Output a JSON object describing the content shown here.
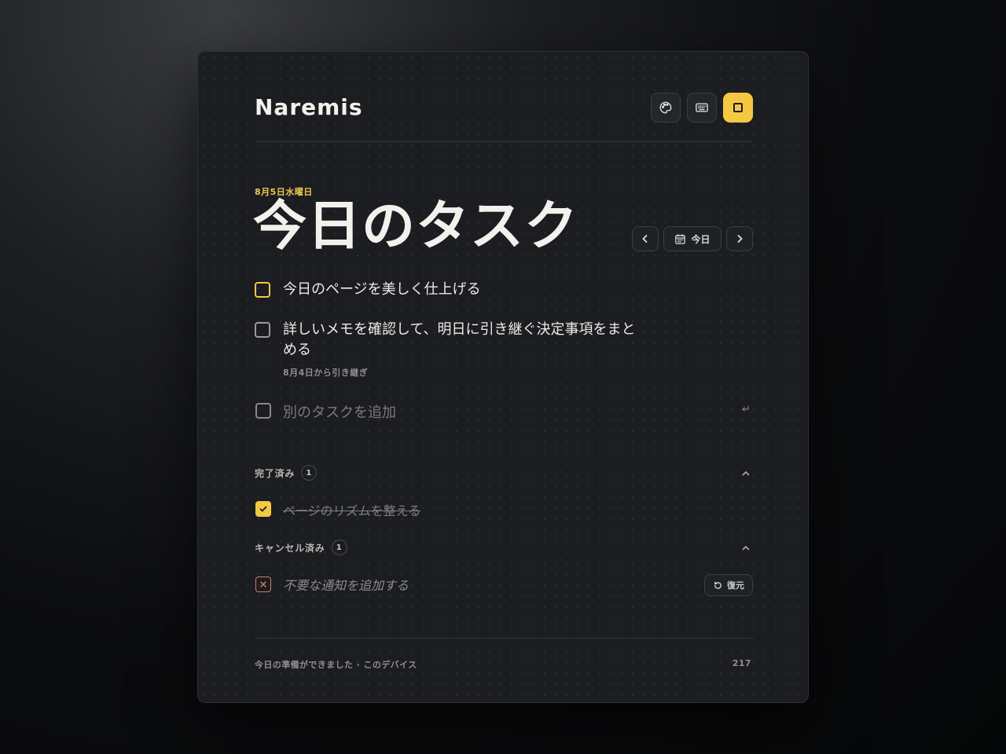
{
  "app": {
    "title": "Naremis"
  },
  "toolbar": {
    "theme_icon": "palette-icon",
    "keyboard_icon": "keyboard-icon",
    "focus_icon": "square-icon",
    "accent": "#f5c842"
  },
  "header": {
    "date": "8月5日水曜日",
    "title": "今日のタスク"
  },
  "date_nav": {
    "today_label": "今日"
  },
  "tasks": [
    {
      "text": "今日のページを美しく仕上げる",
      "note": ""
    },
    {
      "text": "詳しいメモを確認して、明日に引き継ぐ決定事項をまとめる",
      "note": "8月4日から引き継ぎ"
    }
  ],
  "new_task": {
    "placeholder": "別のタスクを追加",
    "enter_hint": "↵"
  },
  "completed": {
    "label": "完了済み",
    "count": "1",
    "items": [
      {
        "text": "ページのリズムを整える"
      }
    ]
  },
  "cancelled": {
    "label": "キャンセル済み",
    "count": "1",
    "items": [
      {
        "text": "不要な通知を追加する",
        "restore_label": "復元"
      }
    ]
  },
  "footer": {
    "status": "今日の準備ができました · このデバイス",
    "count": "217"
  }
}
